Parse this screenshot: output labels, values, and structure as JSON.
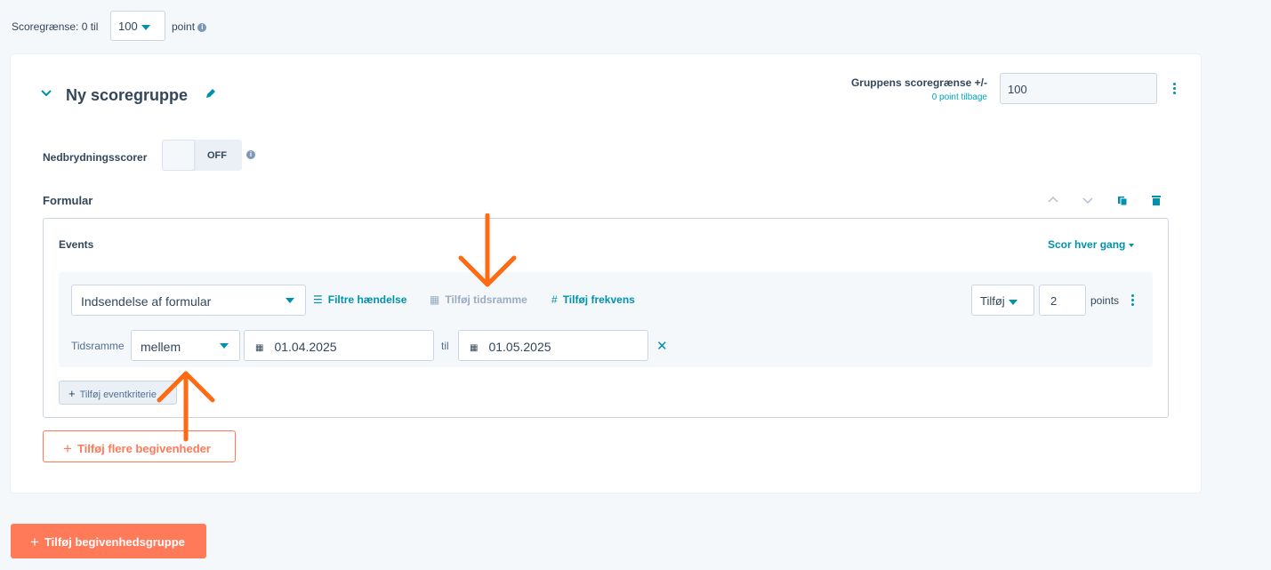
{
  "top": {
    "score_limit_label": "Scoregrænse: 0 til",
    "score_limit_value": "100",
    "point_label": "point"
  },
  "group": {
    "title": "Ny scoregruppe",
    "limit_label": "Gruppens scoregrænse +/-",
    "limit_sub": "0 point tilbage",
    "limit_value": "100",
    "breakdown_label": "Nedbrydningsscorer",
    "toggle_state": "OFF"
  },
  "section": {
    "title": "Formular",
    "events_label": "Events",
    "score_mode": "Scor hver gang",
    "event_type": "Indsendelse af formular",
    "filter_link": "Filtre hændelse",
    "timeframe_link": "Tilføj tidsramme",
    "frequency_link": "Tilføj frekvens",
    "add_select": "Tilføj",
    "points_value": "2",
    "points_label": "points",
    "timeframe_label": "Tidsramme",
    "timeframe_operator": "mellem",
    "date_from": "01.04.2025",
    "til_label": "til",
    "date_to": "01.05.2025",
    "add_criteria": "Tilføj eventkriterie"
  },
  "buttons": {
    "add_more_events": "Tilføj flere begivenheder",
    "add_event_group": "Tilføj begivenhedsgruppe"
  },
  "colors": {
    "accent_teal": "#0091ae",
    "brand_orange": "#ff7a59",
    "annotation_orange": "#ff6a13"
  },
  "icons": [
    "info-icon",
    "chevron-down-icon",
    "pencil-icon",
    "kebab-icon",
    "chevron-up-icon",
    "copy-icon",
    "trash-icon",
    "filter-icon",
    "calendar-icon",
    "hash-icon",
    "close-icon",
    "plus-icon",
    "arrow-down-annotation",
    "arrow-up-annotation"
  ]
}
